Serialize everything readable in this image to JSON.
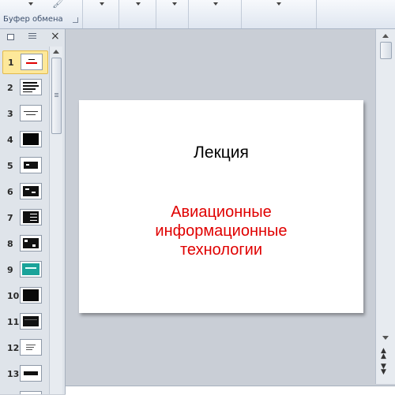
{
  "ribbon": {
    "clipboard_group_label": "Буфер обмена"
  },
  "panel": {
    "close_label": "×",
    "slides": [
      {
        "number": "1"
      },
      {
        "number": "2"
      },
      {
        "number": "3"
      },
      {
        "number": "4"
      },
      {
        "number": "5"
      },
      {
        "number": "6"
      },
      {
        "number": "7"
      },
      {
        "number": "8"
      },
      {
        "number": "9"
      },
      {
        "number": "10"
      },
      {
        "number": "11"
      },
      {
        "number": "12"
      },
      {
        "number": "13"
      }
    ],
    "selected_slide": "1"
  },
  "slide": {
    "title": "Лекция",
    "subtitle": "Авиационные информационные технологии",
    "subtitle_color": "#e00000"
  },
  "icons": [
    "brush-icon",
    "dropdown-arrow-icon",
    "slides-tab-icon",
    "outline-tab-icon",
    "close-icon"
  ]
}
